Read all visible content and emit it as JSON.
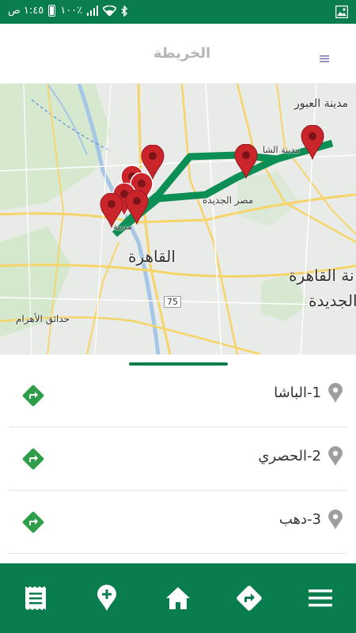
{
  "status_bar": {
    "time": "١:٤٥ ص",
    "battery": "١٠٠٪",
    "icons": [
      "gallery-icon",
      "bluetooth-icon",
      "wifi-icon",
      "signal-icon",
      "battery-icon"
    ]
  },
  "app_bar": {
    "title": "الخريطة",
    "menu_icon": "hamburger-icon"
  },
  "map": {
    "labels": {
      "obour": "مدينة العبور",
      "nasr_city": "مدينة الشا",
      "heliopolis": "مصر الجديدة",
      "nasr_short": "مدينة",
      "cairo": "القاهرة",
      "new_cairo_1": "نة القاهرة",
      "new_cairo_2": "الجديدة",
      "road_75": "75",
      "pyramids_gardens": "حدائق الأهرام"
    },
    "route_color": "#0c8f55",
    "marker_color": "#c9252b"
  },
  "list": {
    "items": [
      {
        "name": "1-الباشا"
      },
      {
        "name": "2-الحصري"
      },
      {
        "name": "3-دهب"
      }
    ]
  },
  "colors": {
    "primary": "#0a7d4e",
    "direction_icon": "#2e9e48",
    "pin_icon": "#9e9e9e"
  },
  "bottom_nav": {
    "items": [
      "receipt-icon",
      "add-location-icon",
      "home-icon",
      "directions-icon",
      "menu-icon"
    ]
  }
}
